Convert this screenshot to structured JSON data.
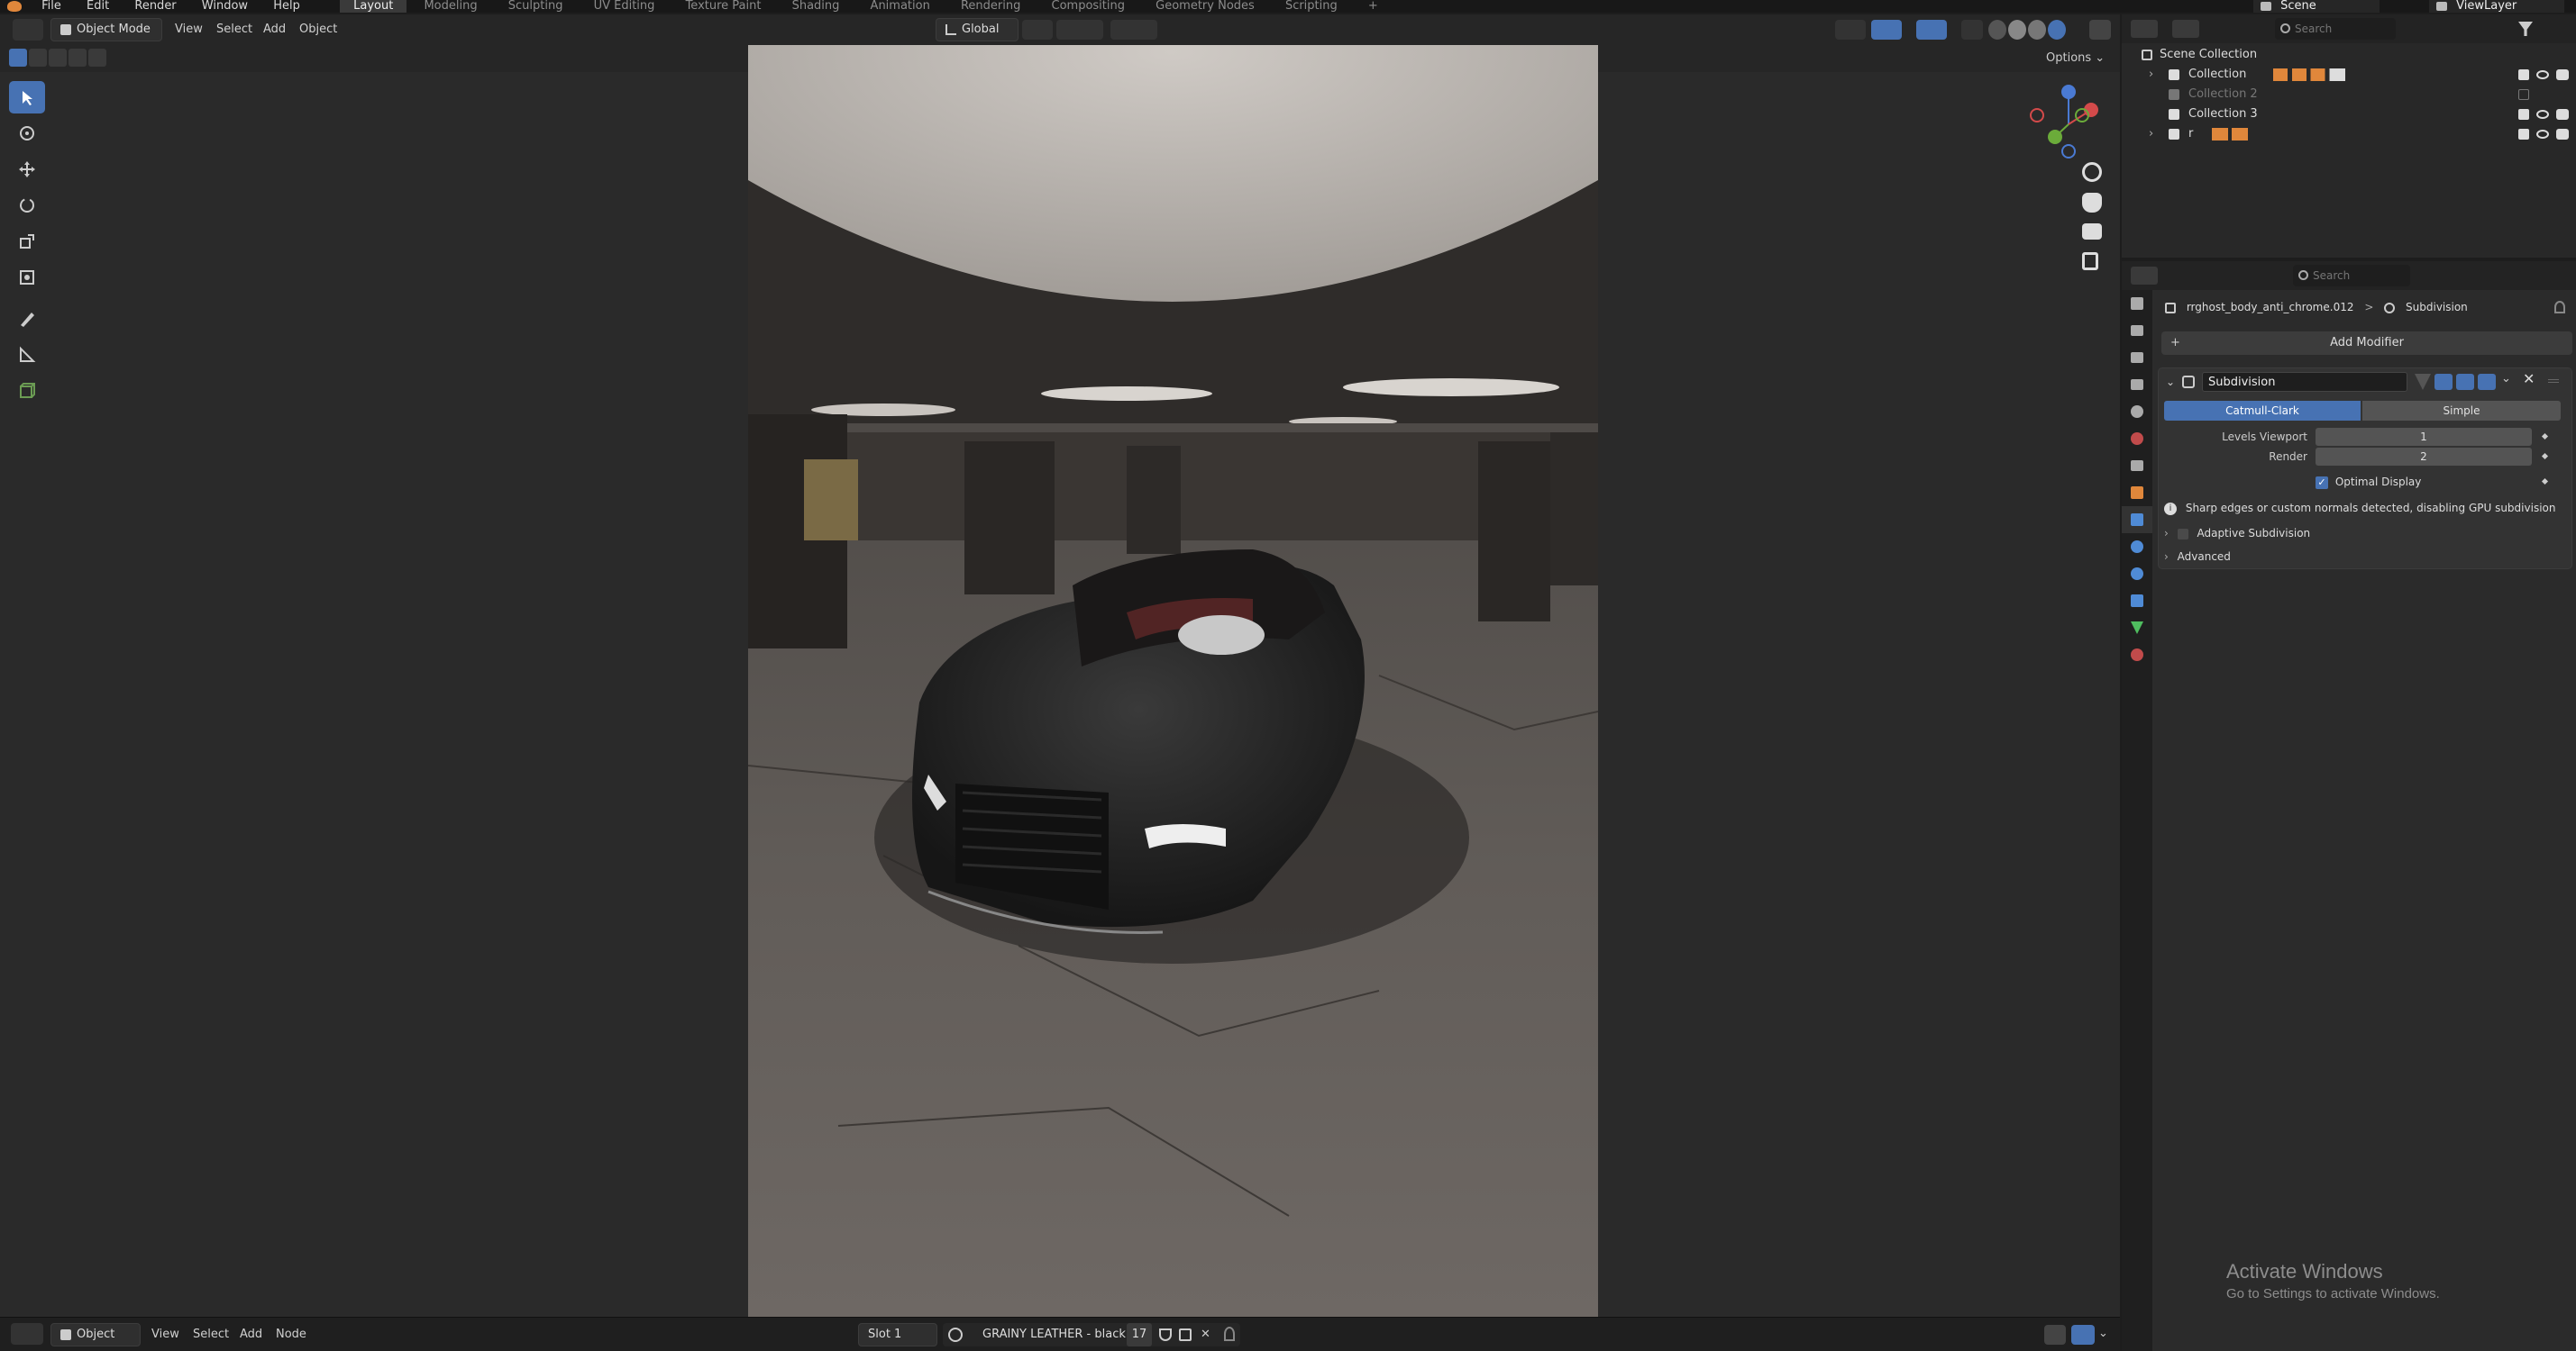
{
  "topbar": {
    "menus": [
      "File",
      "Edit",
      "Render",
      "Window",
      "Help"
    ],
    "workspaces": [
      "Layout",
      "Modeling",
      "Sculpting",
      "UV Editing",
      "Texture Paint",
      "Shading",
      "Animation",
      "Rendering",
      "Compositing",
      "Geometry Nodes",
      "Scripting"
    ],
    "active_workspace": "Layout",
    "add_workspace": "+",
    "scene_label": "Scene",
    "viewlayer_label": "ViewLayer"
  },
  "viewport_header": {
    "mode": "Object Mode",
    "menus": [
      "View",
      "Select",
      "Add",
      "Object"
    ],
    "orientation": "Global",
    "options_label": "Options",
    "search_placeholder": "Search"
  },
  "outliner": {
    "search_placeholder": "Search",
    "root": "Scene Collection",
    "items": [
      {
        "label": "Collection",
        "dim": false
      },
      {
        "label": "Collection 2",
        "dim": true
      },
      {
        "label": "Collection 3",
        "dim": false
      },
      {
        "label": "r",
        "dim": false
      }
    ]
  },
  "properties": {
    "search_placeholder": "Search",
    "breadcrumb_object": "rrghost_body_anti_chrome.012",
    "breadcrumb_sep": ">",
    "breadcrumb_modifier": "Subdivision",
    "add_modifier": "Add Modifier",
    "modifier": {
      "name": "Subdivision",
      "type_options": [
        "Catmull-Clark",
        "Simple"
      ],
      "active_type": "Catmull-Clark",
      "levels_viewport_label": "Levels Viewport",
      "levels_viewport": "1",
      "render_label": "Render",
      "render": "2",
      "optimal_display_label": "Optimal Display",
      "optimal_display_checked": true,
      "warning": "Sharp edges or custom normals detected, disabling GPU subdivision",
      "adaptive_label": "Adaptive Subdivision",
      "advanced_label": "Advanced"
    }
  },
  "footer": {
    "editor_type": "Object",
    "menus": [
      "View",
      "Select",
      "Add",
      "Node"
    ],
    "slot": "Slot 1",
    "material": "GRAINY LEATHER - black",
    "users": "17"
  },
  "watermark": {
    "title": "Activate Windows",
    "subtitle": "Go to Settings to activate Windows."
  },
  "colors": {
    "accent": "#4772b3",
    "bg": "#1d1d1d",
    "panel": "#2b2b2b"
  }
}
